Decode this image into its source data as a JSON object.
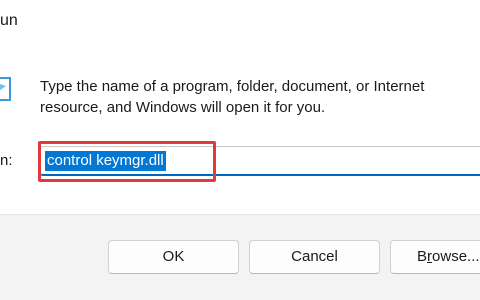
{
  "window": {
    "title": "un"
  },
  "dialog": {
    "description_line1": "Type the name of a program, folder, document, or Internet",
    "description_line2": "resource, and Windows will open it for you.",
    "open_label": "n:",
    "open_value": "control keymgr.dll"
  },
  "buttons": {
    "ok_label": "OK",
    "cancel_label": "Cancel",
    "browse_label_prefix": "B",
    "browse_label_underlined": "r",
    "browse_label_suffix": "owse..."
  },
  "icons": {
    "app": "run-icon"
  },
  "colors": {
    "selection": "#0078d4",
    "highlight_box": "#e23a3a",
    "focus_underline": "#0067c0",
    "footer_bg": "#f3f3f3"
  }
}
